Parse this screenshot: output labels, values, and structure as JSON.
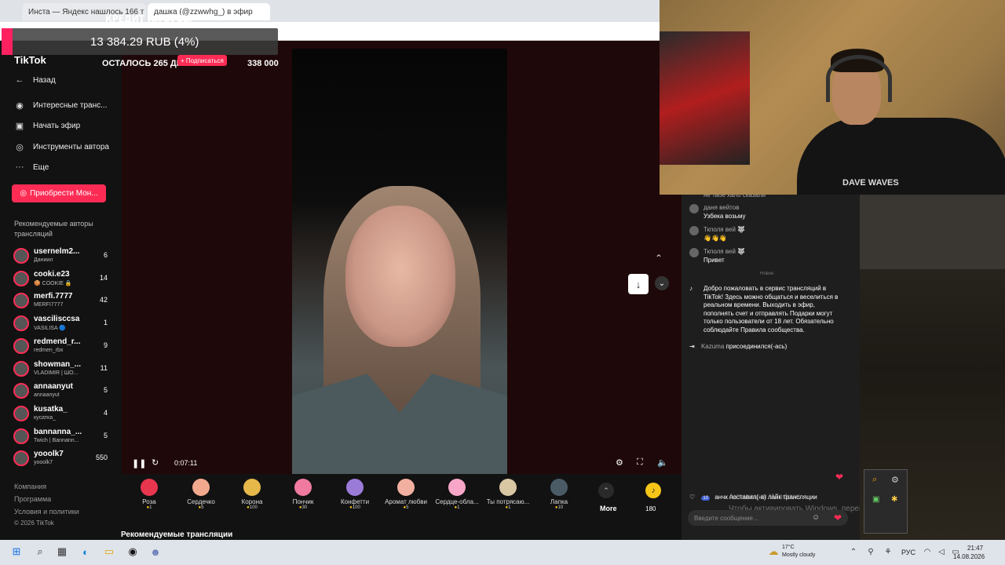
{
  "browser": {
    "tab1_title": "Инста — Яндекс нашлось 166 т",
    "tab2_title": "дашка (@zzwwhg_) в эфир"
  },
  "donation_widget": {
    "title": "КРЕДИТ НА ЗУБЫ",
    "amount": "13 384.29 RUB (4%)",
    "progress_percent": 4,
    "days_left": "ОСТАЛОСЬ 265 ДНЕЙ",
    "goal": "338 000"
  },
  "tiktok": {
    "logo": "TikTok",
    "subscribe_chip": "+ Подписаться",
    "nav": {
      "back": "Назад",
      "interesting": "Интересные транс...",
      "start_live": "Начать эфир",
      "creator_tools": "Инструменты автора",
      "more": "Еще"
    },
    "coins_button": "Приобрести Мон...",
    "recommended_title": "Рекомендуемые авторы трансляций",
    "creators": [
      {
        "name": "usernelm2...",
        "sub": "Даниил",
        "count": "6"
      },
      {
        "name": "cooki.e23",
        "sub": "🍪 COOKIE 🔒",
        "count": "14"
      },
      {
        "name": "merfi.7777",
        "sub": "MERFI7777",
        "count": "42"
      },
      {
        "name": "vascilisccsa",
        "sub": "VASILISA 🔵",
        "count": "1"
      },
      {
        "name": "redmend_r...",
        "sub": "redmen_rbx",
        "count": "9"
      },
      {
        "name": "showman_...",
        "sub": "VLADIMIR | ШО...",
        "count": "11"
      },
      {
        "name": "annaanyut",
        "sub": "annaanyut",
        "count": "5"
      },
      {
        "name": "kusatka_",
        "sub": "кусатка_",
        "count": "4"
      },
      {
        "name": "bannanna_...",
        "sub": "Twich | Bannann...",
        "count": "5"
      },
      {
        "name": "yooolk7",
        "sub": "yooolk7",
        "count": "550"
      }
    ],
    "footer": {
      "company": "Компания",
      "program": "Программа",
      "terms": "Условия и политики",
      "copyright": "© 2026 TikTok"
    },
    "player": {
      "time": "0:07:11"
    },
    "gifts": [
      {
        "name": "Роза",
        "price": "1",
        "color": "#e8364f"
      },
      {
        "name": "Сердечко",
        "price": "5",
        "color": "#f3a98e"
      },
      {
        "name": "Корона",
        "price": "100",
        "color": "#e6b84a"
      },
      {
        "name": "Пончик",
        "price": "30",
        "color": "#f07aa0"
      },
      {
        "name": "Конфетти",
        "price": "100",
        "color": "#9b7bd8"
      },
      {
        "name": "Аромат любви",
        "price": "5",
        "color": "#f2b0a0"
      },
      {
        "name": "Сердце-обла...",
        "price": "1",
        "color": "#f7a6c8"
      },
      {
        "name": "Ты потрясаю...",
        "price": "1",
        "color": "#d9c6a3"
      },
      {
        "name": "Лапка",
        "price": "10",
        "color": "#4b5b66"
      }
    ],
    "gift_more": "More",
    "coin_balance": "180",
    "recommended_live": "Рекомендуемые трансляции"
  },
  "chat": {
    "cut_line": "не твое хало сказали",
    "messages": [
      {
        "name": "даня вейтов",
        "text": "Узбека возьму"
      },
      {
        "name": "Ткполя вей 🐺",
        "text": "👋👋👋"
      },
      {
        "name": "Ткполя вей 🐺",
        "text": "Привет"
      }
    ],
    "new_divider": "Новое",
    "welcome": "Добро пожаловать в сервис трансляций в TikTok! Здесь можно общаться и веселиться в реальном времени. Выходить в эфир, пополнять счет и отправлять Подарки могут только пользователи от 18 лет. Обязательно соблюдайте Правила сообщества.",
    "join_name": "Kazuma",
    "join_text": "присоединился(-ась)",
    "like_line": "анчк поставил(-а) лайк трансляции",
    "like_badge": "10",
    "input_placeholder": "Введите сообщение..."
  },
  "webcam": {
    "shirt_text": "DAVE WAVES"
  },
  "windows_watermark": {
    "line1": "Активация Windows",
    "line2": "Чтобы активировать Windows, перейдите в раздел \"Параметры\"."
  },
  "taskbar": {
    "weather_temp": "17°C",
    "weather_cond": "Mostly cloudy",
    "lang": "РУС",
    "time": "21:47",
    "date": "14.08.2026"
  }
}
